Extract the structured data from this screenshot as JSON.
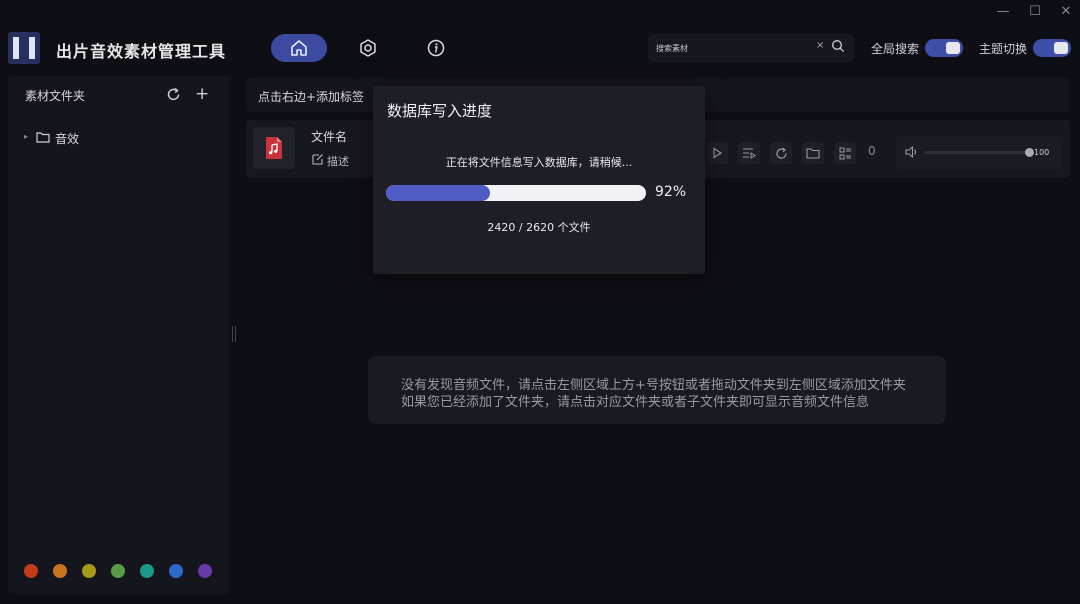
{
  "window": {
    "minimize_glyph": "—",
    "maximize_glyph": "☐",
    "close_glyph": "✕"
  },
  "header": {
    "app_title": "出片音效素材管理工具",
    "nav": [
      {
        "icon": "home-icon",
        "active": true
      },
      {
        "icon": "settings-icon",
        "active": false
      },
      {
        "icon": "info-icon",
        "active": false
      }
    ],
    "search": {
      "placeholder": "搜索素材",
      "value": "",
      "clear_glyph": "×"
    },
    "global_search_label": "全局搜索",
    "theme_switch_label": "主题切换",
    "accent_color": "#3d4ea8"
  },
  "sidebar": {
    "title": "素材文件夹",
    "add_glyph": "+",
    "tree": [
      {
        "label": "音效",
        "expand_glyph": "▸"
      }
    ],
    "color_dots": [
      "#c23a1a",
      "#c8741a",
      "#a8981a",
      "#5a9a4a",
      "#1a9a8a",
      "#2a6ac8",
      "#6a3aaa"
    ]
  },
  "main": {
    "tag_hint": "点击右边+添加标签",
    "file_card": {
      "name_label": "文件名",
      "desc_label": "描述",
      "count": "0",
      "volume": "100"
    },
    "empty_message": {
      "line1": "没有发现音频文件，请点击左侧区域上方+号按钮或者拖动文件夹到左侧区域添加文件夹",
      "line2": "如果您已经添加了文件夹，请点击对应文件夹或者子文件夹即可显示音频文件信息"
    }
  },
  "dialog": {
    "title": "数据库写入进度",
    "status": "正在将文件信息写入数据库，请稍候...",
    "progress_percent": 92,
    "progress_fill_fraction": 0.4,
    "progress_label": "92%",
    "count_text": "2420 / 2620 个文件"
  }
}
